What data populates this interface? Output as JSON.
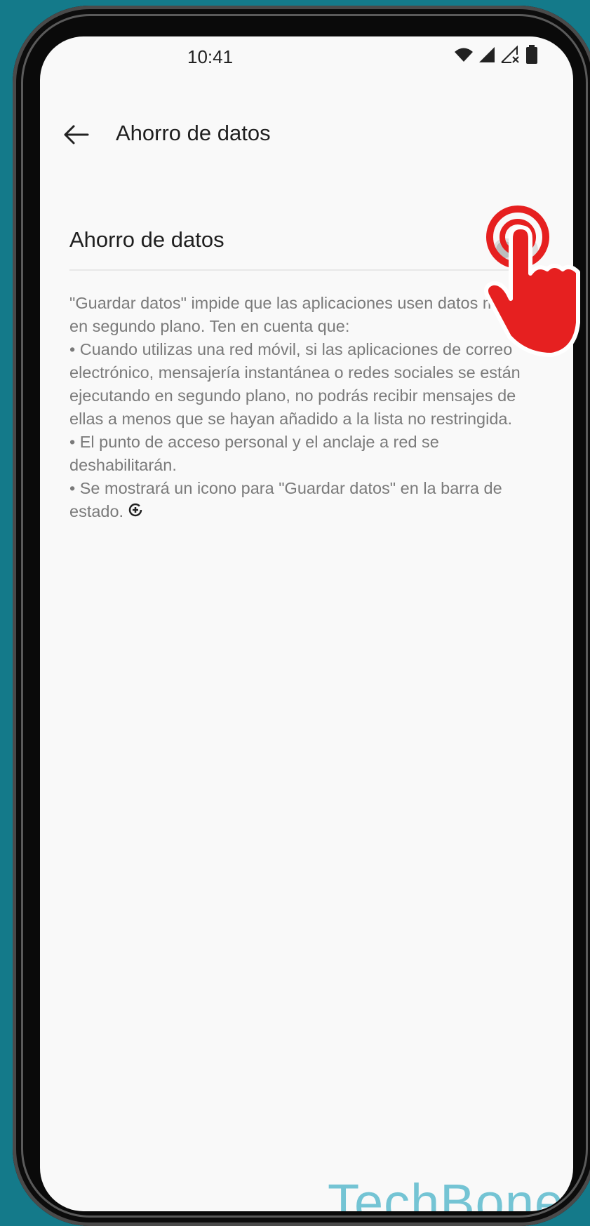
{
  "status_bar": {
    "time": "10:41",
    "icons": [
      "wifi-icon",
      "signal-icon",
      "signal-no-sim-icon",
      "battery-icon"
    ]
  },
  "app_bar": {
    "back_icon": "back-arrow-icon",
    "title": "Ahorro de datos"
  },
  "setting": {
    "label": "Ahorro de datos",
    "toggle_state": "off"
  },
  "description": {
    "lines": [
      "\"Guardar datos\" impide que las aplicaciones usen datos móviles en segundo plano. Ten en cuenta que:",
      "• Cuando utilizas una red móvil, si las aplicaciones de correo electrónico, mensajería instantánea o redes sociales se están ejecutando en segundo plano, no podrás recibir mensajes de ellas a menos que se hayan añadido a la lista no restringida.",
      "• El punto de acceso personal y el anclaje a red se deshabilitarán.",
      "• Se mostrará un icono para \"Guardar datos\" en la barra de estado."
    ],
    "trailing_icon": "data-saver-icon"
  },
  "overlay": {
    "pointer_icon": "tap-hand-icon",
    "accent_color": "#e62020"
  },
  "watermark": {
    "text": "TechBone",
    "color": "#74c4d4"
  }
}
